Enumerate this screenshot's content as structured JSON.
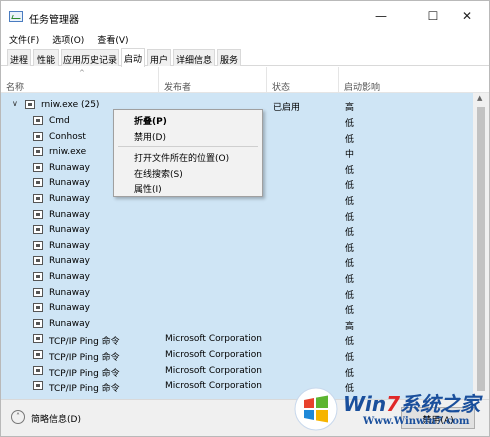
{
  "window": {
    "title": "任务管理器"
  },
  "window_controls": {
    "minimize": "—",
    "maximize": "☐",
    "close": "✕"
  },
  "menu": [
    "文件(F)",
    "选项(O)",
    "查看(V)"
  ],
  "tabs": [
    "进程",
    "性能",
    "应用历史记录",
    "启动",
    "用户",
    "详细信息",
    "服务"
  ],
  "active_tab": "启动",
  "columns": {
    "name": "名称",
    "publisher": "发布者",
    "status": "状态",
    "impact": "启动影响"
  },
  "group": {
    "name": "rniw.exe (25)",
    "status": "已启用",
    "impact": "高"
  },
  "rows": [
    {
      "name": "Cmd",
      "publisher": "",
      "impact": "低"
    },
    {
      "name": "Conhost",
      "publisher": "",
      "impact": "低"
    },
    {
      "name": "rniw.exe",
      "publisher": "",
      "impact": "中"
    },
    {
      "name": "Runaway",
      "publisher": "",
      "impact": "低"
    },
    {
      "name": "Runaway",
      "publisher": "",
      "impact": "低"
    },
    {
      "name": "Runaway",
      "publisher": "",
      "impact": "低"
    },
    {
      "name": "Runaway",
      "publisher": "",
      "impact": "低"
    },
    {
      "name": "Runaway",
      "publisher": "",
      "impact": "低"
    },
    {
      "name": "Runaway",
      "publisher": "",
      "impact": "低"
    },
    {
      "name": "Runaway",
      "publisher": "",
      "impact": "低"
    },
    {
      "name": "Runaway",
      "publisher": "",
      "impact": "低"
    },
    {
      "name": "Runaway",
      "publisher": "",
      "impact": "低"
    },
    {
      "name": "Runaway",
      "publisher": "",
      "impact": "低"
    },
    {
      "name": "Runaway",
      "publisher": "",
      "impact": "高"
    },
    {
      "name": "TCP/IP Ping 命令",
      "publisher": "Microsoft Corporation",
      "impact": "低"
    },
    {
      "name": "TCP/IP Ping 命令",
      "publisher": "Microsoft Corporation",
      "impact": "低"
    },
    {
      "name": "TCP/IP Ping 命令",
      "publisher": "Microsoft Corporation",
      "impact": "低"
    },
    {
      "name": "TCP/IP Ping 命令",
      "publisher": "Microsoft Corporation",
      "impact": "低"
    }
  ],
  "context_menu": {
    "collapse": "折叠(P)",
    "disable": "禁用(D)",
    "open_location": "打开文件所在的位置(O)",
    "search_online": "在线搜索(S)",
    "properties": "属性(I)"
  },
  "footer": {
    "fewer_details": "简略信息(D)",
    "disable_button": "禁用(A)"
  },
  "watermark": {
    "brand_prefix": "Win",
    "brand_num": "7",
    "brand_suffix": "系统之家",
    "url": "Www.Winwin7.com"
  },
  "colors": {
    "selection": "#cfe5f5",
    "watermark_blue": "#1a4f9c",
    "watermark_red": "#e02828"
  }
}
